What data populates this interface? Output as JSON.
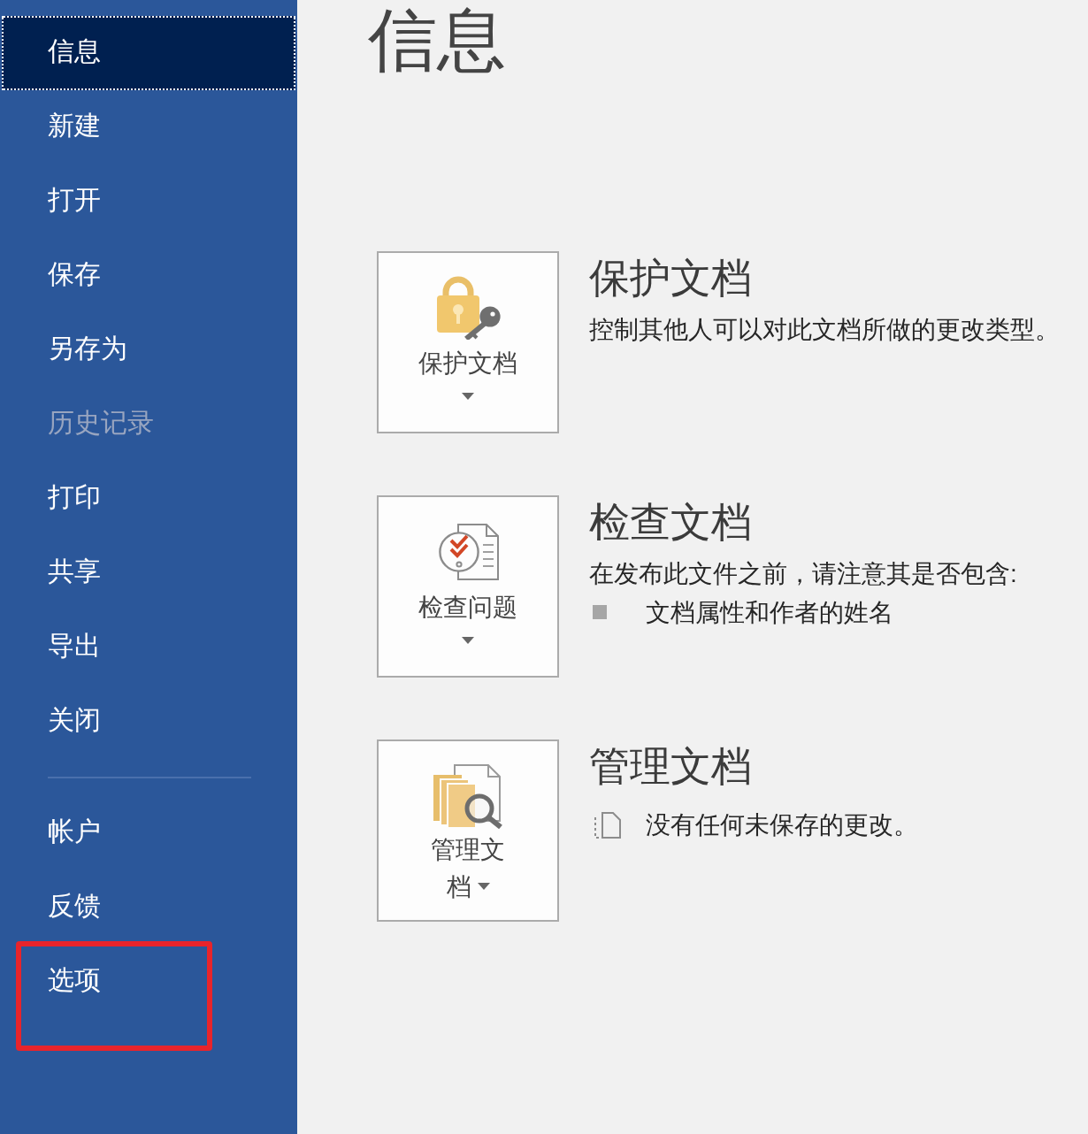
{
  "sidebar": {
    "groups": [
      {
        "items": [
          {
            "label": "信息",
            "selected": true,
            "disabled": false,
            "highlighted": false
          },
          {
            "label": "新建",
            "selected": false,
            "disabled": false,
            "highlighted": false
          },
          {
            "label": "打开",
            "selected": false,
            "disabled": false,
            "highlighted": false
          },
          {
            "label": "保存",
            "selected": false,
            "disabled": false,
            "highlighted": false
          },
          {
            "label": "另存为",
            "selected": false,
            "disabled": false,
            "highlighted": false
          },
          {
            "label": "历史记录",
            "selected": false,
            "disabled": true,
            "highlighted": false
          },
          {
            "label": "打印",
            "selected": false,
            "disabled": false,
            "highlighted": false
          },
          {
            "label": "共享",
            "selected": false,
            "disabled": false,
            "highlighted": false
          },
          {
            "label": "导出",
            "selected": false,
            "disabled": false,
            "highlighted": false
          },
          {
            "label": "关闭",
            "selected": false,
            "disabled": false,
            "highlighted": false
          }
        ]
      },
      {
        "items": [
          {
            "label": "帐户",
            "selected": false,
            "disabled": false,
            "highlighted": false
          },
          {
            "label": "反馈",
            "selected": false,
            "disabled": false,
            "highlighted": false
          },
          {
            "label": "选项",
            "selected": false,
            "disabled": false,
            "highlighted": true
          }
        ]
      }
    ]
  },
  "page": {
    "title": "信息"
  },
  "sections": [
    {
      "kind": "protect",
      "button": {
        "label": "保护文档",
        "caret_inline": false
      },
      "heading": "保护文档",
      "description": "控制其他人可以对此文档所做的更改类型。"
    },
    {
      "kind": "inspect",
      "button": {
        "label": "检查问题",
        "caret_inline": false
      },
      "heading": "检查文档",
      "description": "在发布此文件之前，请注意其是否包含:",
      "items": [
        {
          "kind": "bullet",
          "text": "文档属性和作者的姓名"
        }
      ]
    },
    {
      "kind": "manage",
      "button": {
        "label": "管理文档",
        "caret_inline": true
      },
      "heading": "管理文档",
      "items": [
        {
          "kind": "file_note",
          "text": "没有任何未保存的更改。"
        }
      ]
    }
  ]
}
